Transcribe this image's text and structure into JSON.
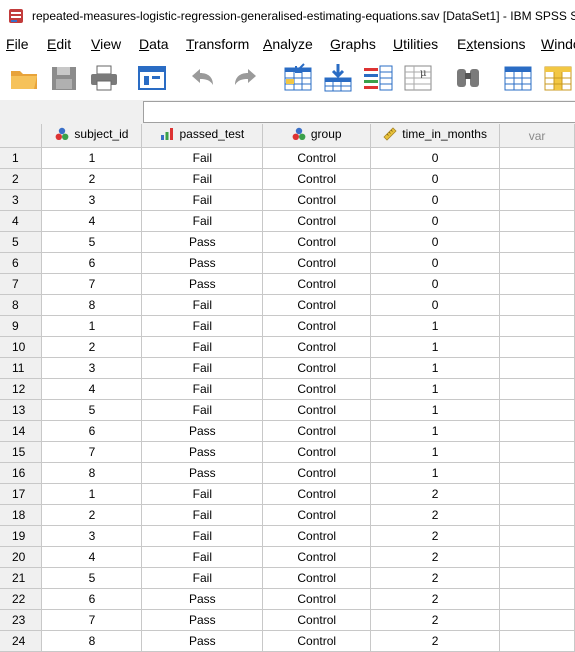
{
  "window": {
    "title": "repeated-measures-logistic-regression-generalised-estimating-equations.sav [DataSet1] - IBM SPSS Statistics Data Editor"
  },
  "menu": [
    {
      "label": "File",
      "u": "F"
    },
    {
      "label": "Edit",
      "u": "E"
    },
    {
      "label": "View",
      "u": "V"
    },
    {
      "label": "Data",
      "u": "D"
    },
    {
      "label": "Transform",
      "u": "T"
    },
    {
      "label": "Analyze",
      "u": "A"
    },
    {
      "label": "Graphs",
      "u": "G"
    },
    {
      "label": "Utilities",
      "u": "U"
    },
    {
      "label": "Extensions",
      "u": "x"
    },
    {
      "label": "Window",
      "u": "W"
    }
  ],
  "toolbar": {
    "icons": [
      "open-folder-icon",
      "save-icon",
      "print-icon",
      "recall-dialog-icon",
      "undo-icon",
      "redo-icon",
      "goto-case-icon",
      "goto-variable-icon",
      "variables-icon",
      "descriptives-icon",
      "find-icon",
      "insert-cases-icon",
      "insert-variable-icon"
    ]
  },
  "columns": [
    {
      "name": "subject_id",
      "icon": "nominal-icon"
    },
    {
      "name": "passed_test",
      "icon": "ordinal-icon"
    },
    {
      "name": "group",
      "icon": "nominal-icon"
    },
    {
      "name": "time_in_months",
      "icon": "scale-icon"
    },
    {
      "name": "var",
      "icon": ""
    }
  ],
  "rows": [
    [
      "1",
      "1",
      "Fail",
      "Control",
      "0"
    ],
    [
      "2",
      "2",
      "Fail",
      "Control",
      "0"
    ],
    [
      "3",
      "3",
      "Fail",
      "Control",
      "0"
    ],
    [
      "4",
      "4",
      "Fail",
      "Control",
      "0"
    ],
    [
      "5",
      "5",
      "Pass",
      "Control",
      "0"
    ],
    [
      "6",
      "6",
      "Pass",
      "Control",
      "0"
    ],
    [
      "7",
      "7",
      "Pass",
      "Control",
      "0"
    ],
    [
      "8",
      "8",
      "Fail",
      "Control",
      "0"
    ],
    [
      "9",
      "1",
      "Fail",
      "Control",
      "1"
    ],
    [
      "10",
      "2",
      "Fail",
      "Control",
      "1"
    ],
    [
      "11",
      "3",
      "Fail",
      "Control",
      "1"
    ],
    [
      "12",
      "4",
      "Fail",
      "Control",
      "1"
    ],
    [
      "13",
      "5",
      "Fail",
      "Control",
      "1"
    ],
    [
      "14",
      "6",
      "Pass",
      "Control",
      "1"
    ],
    [
      "15",
      "7",
      "Pass",
      "Control",
      "1"
    ],
    [
      "16",
      "8",
      "Pass",
      "Control",
      "1"
    ],
    [
      "17",
      "1",
      "Fail",
      "Control",
      "2"
    ],
    [
      "18",
      "2",
      "Fail",
      "Control",
      "2"
    ],
    [
      "19",
      "3",
      "Fail",
      "Control",
      "2"
    ],
    [
      "20",
      "4",
      "Fail",
      "Control",
      "2"
    ],
    [
      "21",
      "5",
      "Fail",
      "Control",
      "2"
    ],
    [
      "22",
      "6",
      "Pass",
      "Control",
      "2"
    ],
    [
      "23",
      "7",
      "Pass",
      "Control",
      "2"
    ],
    [
      "24",
      "8",
      "Pass",
      "Control",
      "2"
    ]
  ]
}
